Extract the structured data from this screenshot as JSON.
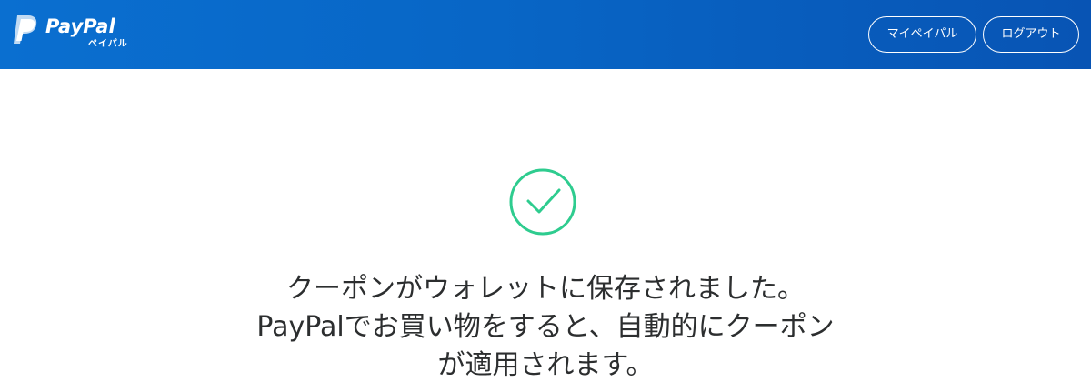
{
  "header": {
    "logo_text": "PayPal",
    "logo_subtext": "ペイパル",
    "my_paypal_label": "マイペイパル",
    "logout_label": "ログアウト"
  },
  "main": {
    "status_icon": "check-circle-icon",
    "message_lines": [
      "クーポンがウォレットに保存されました。",
      "PayPalでお買い物をすると、自動的にクーポン",
      "が適用されます。"
    ]
  },
  "colors": {
    "header_blue": "#0866c6",
    "success_green": "#2ecc8f",
    "text": "#2c2e2f"
  }
}
